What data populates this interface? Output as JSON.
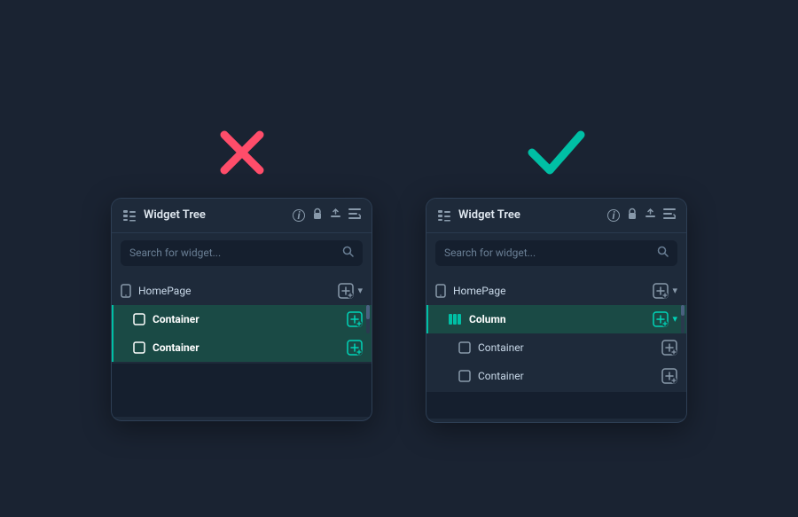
{
  "page": {
    "bg_color": "#1a2332"
  },
  "left_panel": {
    "mark_type": "wrong",
    "header": {
      "title": "Widget Tree",
      "info_icon": "ℹ",
      "lock_icon": "🔒",
      "upload_icon": "⬆",
      "sort_icon": "≡↕"
    },
    "search": {
      "placeholder": "Search for widget...",
      "search_icon": "🔍"
    },
    "tree": {
      "homepage": {
        "label": "HomePage",
        "icon": "phone"
      },
      "items": [
        {
          "label": "Container",
          "icon": "square",
          "highlighted": true,
          "bold": true
        },
        {
          "label": "Container",
          "icon": "square",
          "highlighted": true,
          "bold": true
        }
      ]
    }
  },
  "right_panel": {
    "mark_type": "correct",
    "header": {
      "title": "Widget Tree",
      "info_icon": "ℹ",
      "lock_icon": "🔒",
      "upload_icon": "⬆",
      "sort_icon": "≡↕"
    },
    "search": {
      "placeholder": "Search for widget...",
      "search_icon": "🔍"
    },
    "tree": {
      "homepage": {
        "label": "HomePage",
        "icon": "phone"
      },
      "parent": {
        "label": "Column",
        "icon": "columns",
        "highlighted": true,
        "bold": true
      },
      "items": [
        {
          "label": "Container",
          "icon": "square",
          "highlighted": false,
          "bold": false
        },
        {
          "label": "Container",
          "icon": "square",
          "highlighted": false,
          "bold": false
        }
      ]
    }
  }
}
